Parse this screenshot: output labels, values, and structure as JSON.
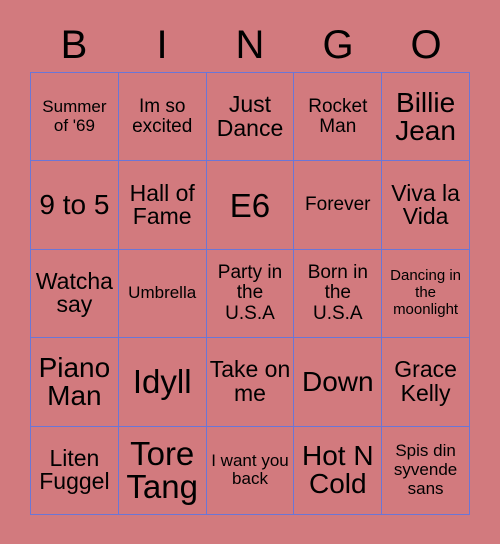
{
  "card": {
    "background_color": "#d27a7e",
    "grid_line_color": "#6b76d6",
    "text_color": "#000000"
  },
  "header": {
    "letters": [
      "B",
      "I",
      "N",
      "G",
      "O"
    ]
  },
  "grid": {
    "rows": 5,
    "columns": 5,
    "cells": [
      {
        "text": "Summer of '69",
        "size": "s"
      },
      {
        "text": "Im so excited",
        "size": "m"
      },
      {
        "text": "Just Dance",
        "size": "l"
      },
      {
        "text": "Rocket Man",
        "size": "m"
      },
      {
        "text": "Billie Jean",
        "size": "xl"
      },
      {
        "text": "9 to 5",
        "size": "xl"
      },
      {
        "text": "Hall of Fame",
        "size": "l"
      },
      {
        "text": "E6",
        "size": "xxl"
      },
      {
        "text": "Forever",
        "size": "m"
      },
      {
        "text": "Viva la Vida",
        "size": "l"
      },
      {
        "text": "Watcha say",
        "size": "l"
      },
      {
        "text": "Umbrella",
        "size": "s"
      },
      {
        "text": "Party in the U.S.A",
        "size": "m"
      },
      {
        "text": "Born in the U.S.A",
        "size": "m"
      },
      {
        "text": "Dancing in the moonlight",
        "size": "xs"
      },
      {
        "text": "Piano Man",
        "size": "xl"
      },
      {
        "text": "Idyll",
        "size": "xxl"
      },
      {
        "text": "Take on me",
        "size": "l"
      },
      {
        "text": "Down",
        "size": "xl"
      },
      {
        "text": "Grace Kelly",
        "size": "l"
      },
      {
        "text": "Liten Fuggel",
        "size": "l"
      },
      {
        "text": "Tore Tang",
        "size": "xxl"
      },
      {
        "text": "I want you back",
        "size": "s"
      },
      {
        "text": "Hot N Cold",
        "size": "xl"
      },
      {
        "text": "Spis din syvende sans",
        "size": "s"
      }
    ]
  }
}
